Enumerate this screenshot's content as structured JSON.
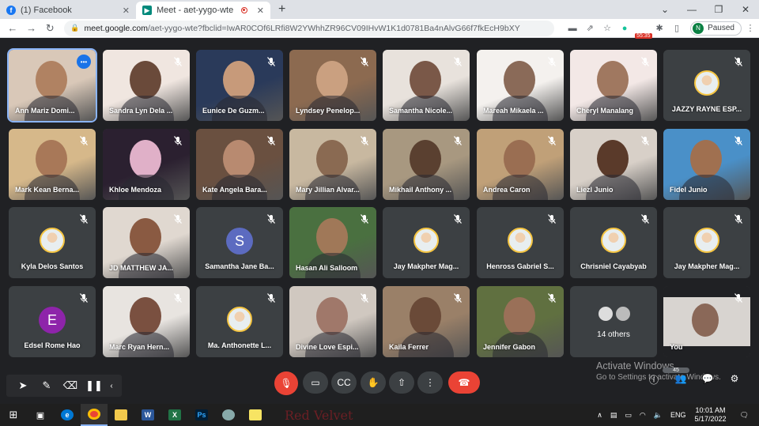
{
  "browser": {
    "tabs": [
      {
        "title": "(1) Facebook",
        "icon": "facebook-icon",
        "active": false
      },
      {
        "title": "Meet - aet-yygo-wte",
        "icon": "google-meet-icon",
        "active": true
      }
    ],
    "url_host": "meet.google.com",
    "url_path": "/aet-yygo-wte?fbclid=IwAR0COf6LRfi8W2YWhhZR96CV09IHvW1K1d0781Ba4nAlvG66f7fkEcH9bXY",
    "timer_badge": "55:35",
    "profile_initial": "N",
    "profile_status": "Paused"
  },
  "participants": [
    {
      "name": "Ann Mariz Domi...",
      "speaking": true,
      "type": "video"
    },
    {
      "name": "Sandra Lyn Dela ...",
      "type": "video"
    },
    {
      "name": "Eunice De Guzm...",
      "type": "video"
    },
    {
      "name": "Lyndsey Penelop...",
      "type": "video"
    },
    {
      "name": "Samantha Nicole...",
      "type": "video"
    },
    {
      "name": "Mareah Mikaela ...",
      "type": "video"
    },
    {
      "name": "Cheryl Manalang",
      "type": "video"
    },
    {
      "name": "JAZZY RAYNE ESP...",
      "type": "avatar"
    },
    {
      "name": "Mark Kean Berna...",
      "type": "video"
    },
    {
      "name": "Khloe Mendoza",
      "type": "video"
    },
    {
      "name": "Kate Angela Bara...",
      "type": "video"
    },
    {
      "name": "Mary Jillian Alvar...",
      "type": "video"
    },
    {
      "name": "Mikhail Anthony ...",
      "type": "video"
    },
    {
      "name": "Andrea Caron",
      "type": "video"
    },
    {
      "name": "Liezl Junio",
      "type": "video"
    },
    {
      "name": "Fidel Junio",
      "type": "video"
    },
    {
      "name": "Kyla Delos Santos",
      "type": "avatar"
    },
    {
      "name": "JD MATTHEW JA...",
      "type": "video"
    },
    {
      "name": "Samantha Jane Ba...",
      "type": "letter",
      "letter": "S",
      "color": "#5c6bc0"
    },
    {
      "name": "Hasan Ali Salloom",
      "type": "video"
    },
    {
      "name": "Jay Makpher Mag...",
      "type": "avatar"
    },
    {
      "name": "Henross Gabriel S...",
      "type": "avatar"
    },
    {
      "name": "Chrisniel Cayabyab",
      "type": "avatar"
    },
    {
      "name": "Jay Makpher Mag...",
      "type": "avatar"
    },
    {
      "name": "Edsel Rome Hao",
      "type": "letter",
      "letter": "E",
      "color": "#8e24aa"
    },
    {
      "name": "Marc Ryan Hern...",
      "type": "video"
    },
    {
      "name": "Ma. Anthonette L...",
      "type": "avatar"
    },
    {
      "name": "Divine Love Espi...",
      "type": "video"
    },
    {
      "name": "Kaila Ferrer",
      "type": "video"
    },
    {
      "name": "Jennifer Gabon",
      "type": "video"
    },
    {
      "name": "14 others",
      "type": "others"
    },
    {
      "name": "You",
      "type": "self"
    }
  ],
  "meet_controls": {
    "people_count": "45",
    "watermark_title": "Activate Windows",
    "watermark_sub": "Go to Settings to activate Windows."
  },
  "taskbar": {
    "pinned_label": "Red Velvet",
    "language": "ENG",
    "time": "10:01 AM",
    "date": "5/17/2022"
  },
  "colors": {
    "meet_bg": "#202124",
    "tile_bg": "#3c4043",
    "hangup_red": "#ea4335",
    "speaking_blue": "#1a73e8"
  }
}
